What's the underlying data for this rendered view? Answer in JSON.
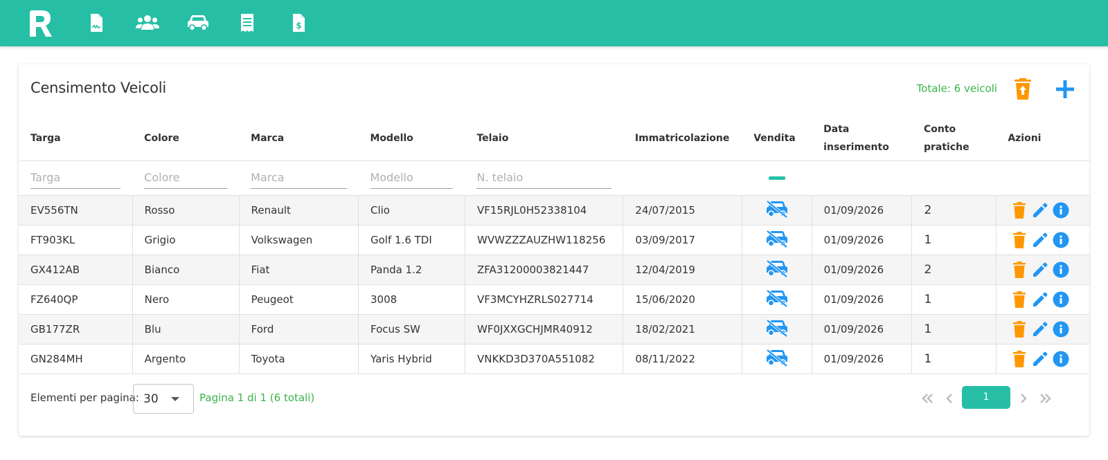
{
  "app": {
    "logo_icon": "r-wrench-logo",
    "nav": [
      {
        "icon": "document-signature-icon"
      },
      {
        "icon": "users-icon"
      },
      {
        "icon": "car-icon"
      },
      {
        "icon": "receipt-icon"
      },
      {
        "icon": "invoice-dollar-icon"
      }
    ],
    "colors": {
      "brand": "#26bfa6",
      "accent_blue": "#2196f3",
      "accent_orange": "#ff9800",
      "success_text": "#3ab54a"
    }
  },
  "card": {
    "title": "Censimento Veicoli",
    "total": "Totale: 6 veicoli",
    "export_icon": "upload-trash-icon",
    "add_icon": "plus-icon"
  },
  "table": {
    "headers": {
      "targa": "Targa",
      "colore": "Colore",
      "marca": "Marca",
      "modello": "Modello",
      "telaio": "Telaio",
      "immatricolazione": "Immatricolazione",
      "vendita": "Vendita",
      "data_inserimento": "Data inserimento",
      "conto_pratiche": "Conto pratiche",
      "azioni": "Azioni"
    },
    "filters": {
      "targa": "Targa",
      "colore": "Colore",
      "marca": "Marca",
      "modello": "Modello",
      "telaio": "N. telaio"
    },
    "rows": [
      {
        "targa": "EV556TN",
        "colore": "Rosso",
        "marca": "Renault",
        "modello": "Clio",
        "telaio": "VF15RJL0H52338104",
        "immatricolazione": "24/07/2015",
        "vendita_icon": "car-off-icon",
        "data_inserimento": "01/09/2026",
        "conto": "2"
      },
      {
        "targa": "FT903KL",
        "colore": "Grigio",
        "marca": "Volkswagen",
        "modello": "Golf 1.6 TDI",
        "telaio": "WVWZZZAUZHW118256",
        "immatricolazione": "03/09/2017",
        "vendita_icon": "car-off-icon",
        "data_inserimento": "01/09/2026",
        "conto": "1"
      },
      {
        "targa": "GX412AB",
        "colore": "Bianco",
        "marca": "Fiat",
        "modello": "Panda 1.2",
        "telaio": "ZFA31200003821447",
        "immatricolazione": "12/04/2019",
        "vendita_icon": "car-off-icon",
        "data_inserimento": "01/09/2026",
        "conto": "2"
      },
      {
        "targa": "FZ640QP",
        "colore": "Nero",
        "marca": "Peugeot",
        "modello": "3008",
        "telaio": "VF3MCYHZRLS027714",
        "immatricolazione": "15/06/2020",
        "vendita_icon": "car-off-icon",
        "data_inserimento": "01/09/2026",
        "conto": "1"
      },
      {
        "targa": "GB177ZR",
        "colore": "Blu",
        "marca": "Ford",
        "modello": "Focus SW",
        "telaio": "WF0JXXGCHJMR40912",
        "immatricolazione": "18/02/2021",
        "vendita_icon": "car-off-icon",
        "data_inserimento": "01/09/2026",
        "conto": "1"
      },
      {
        "targa": "GN284MH",
        "colore": "Argento",
        "marca": "Toyota",
        "modello": "Yaris Hybrid",
        "telaio": "VNKKD3D370A551082",
        "immatricolazione": "08/11/2022",
        "vendita_icon": "car-off-icon",
        "data_inserimento": "01/09/2026",
        "conto": "1"
      }
    ],
    "row_actions": [
      "delete-icon",
      "edit-icon",
      "info-icon"
    ]
  },
  "footer": {
    "per_page_label": "Elementi per pagina:",
    "per_page_value": "30",
    "page_info": "Pagina 1 di 1 (6 totali)",
    "current_page": "1"
  }
}
